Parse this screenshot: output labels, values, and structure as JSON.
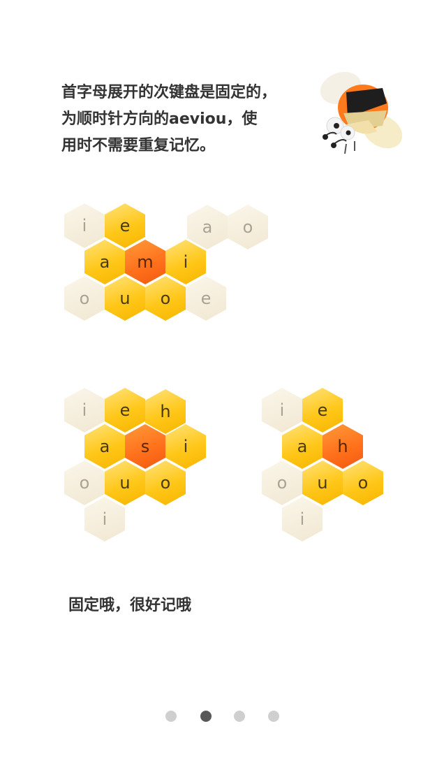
{
  "intro_text": "首字母展开的次键盘是固定的，\n为顺时针方向的aeviou，使\n用时不需要重复记忆。",
  "note_text": "固定哦，很好记哦",
  "bee_icon": "bee-mascot-icon",
  "colors": {
    "yellow": "#ffc719",
    "orange": "#ff6f1a",
    "cream": "#f1e8d2",
    "text": "#333333"
  },
  "keyboard_m": {
    "center": "m",
    "keys": [
      "i",
      "e",
      "a",
      "o",
      "a",
      "m",
      "i",
      "o",
      "u",
      "o",
      "e"
    ]
  },
  "keyboard_s": {
    "center": "s",
    "keys": [
      "i",
      "e",
      "h",
      "a",
      "s",
      "i",
      "o",
      "u",
      "o",
      "i"
    ]
  },
  "keyboard_h": {
    "center": "h",
    "keys": [
      "i",
      "e",
      "a",
      "h",
      "o",
      "u",
      "o",
      "i"
    ]
  },
  "pager": {
    "pages": 4,
    "current": 2
  }
}
